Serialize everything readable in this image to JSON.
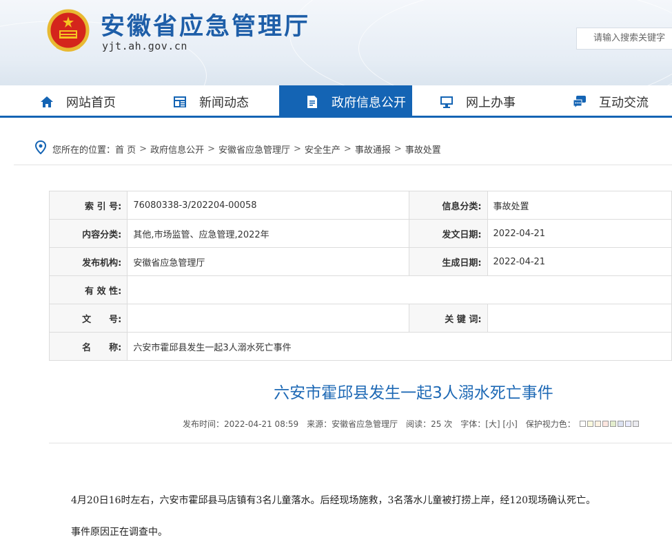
{
  "header": {
    "site_title": "安徽省应急管理厅",
    "domain": "yjt.ah.gov.cn",
    "search_placeholder": "请输入搜索关键字"
  },
  "nav": {
    "items": [
      {
        "label": "网站首页",
        "icon": "home-icon"
      },
      {
        "label": "新闻动态",
        "icon": "news-icon"
      },
      {
        "label": "政府信息公开",
        "icon": "document-icon",
        "active": true
      },
      {
        "label": "网上办事",
        "icon": "monitor-icon"
      },
      {
        "label": "互动交流",
        "icon": "chat-icon"
      }
    ],
    "accent": "#1464b4"
  },
  "breadcrumb": {
    "prefix": "您所在的位置：",
    "items": [
      "首 页",
      "政府信息公开",
      "安徽省应急管理厅",
      "安全生产",
      "事故通报",
      "事故处置"
    ],
    "sep": ">"
  },
  "info": {
    "index_label": "索 引 号:",
    "index_value": "76080338-3/202204-00058",
    "category_label": "信息分类:",
    "category_value": "事故处置",
    "content_label": "内容分类:",
    "content_value": "其他,市场监管、应急管理,2022年",
    "date_label": "发文日期:",
    "date_value": "2022-04-21",
    "org_label": "发布机构:",
    "org_value": "安徽省应急管理厅",
    "gen_label": "生成日期:",
    "gen_value": "2022-04-21",
    "valid_label": "有 效 性:",
    "valid_value": "",
    "doc_label": "文　　号:",
    "doc_value": "",
    "keyword_label": "关 键 词:",
    "keyword_value": "",
    "name_label": "名　　称:",
    "name_value": "六安市霍邱县发生一起3人溺水死亡事件"
  },
  "article": {
    "title": "六安市霍邱县发生一起3人溺水死亡事件",
    "meta_time": "发布时间：2022-04-21 08:59",
    "meta_source": "来源：安徽省应急管理厅",
    "meta_views": "阅读：25 次",
    "meta_font": "字体：[大] [小]",
    "meta_protect": "保护视力色：",
    "paragraphs": [
      "4月20日16时左右，六安市霍邱县马店镇有3名儿童落水。后经现场施救，3名落水儿童被打捞上岸，经120现场确认死亡。",
      "事件原因正在调查中。"
    ],
    "title_color": "#1e69b5"
  }
}
